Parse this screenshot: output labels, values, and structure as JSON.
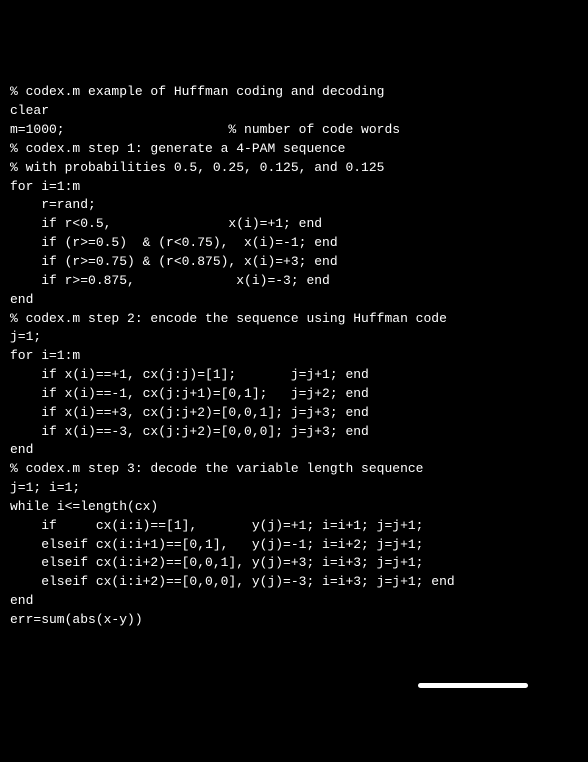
{
  "code": {
    "lines": [
      "% codex.m example of Huffman coding and decoding",
      "clear",
      "m=1000;                     % number of code words",
      "% codex.m step 1: generate a 4-PAM sequence",
      "% with probabilities 0.5, 0.25, 0.125, and 0.125",
      "for i=1:m",
      "    r=rand;",
      "    if r<0.5,               x(i)=+1; end",
      "    if (r>=0.5)  & (r<0.75),  x(i)=-1; end",
      "    if (r>=0.75) & (r<0.875), x(i)=+3; end",
      "    if r>=0.875,             x(i)=-3; end",
      "end",
      "% codex.m step 2: encode the sequence using Huffman code",
      "j=1;",
      "for i=1:m",
      "    if x(i)==+1, cx(j:j)=[1];       j=j+1; end",
      "    if x(i)==-1, cx(j:j+1)=[0,1];   j=j+2; end",
      "    if x(i)==+3, cx(j:j+2)=[0,0,1]; j=j+3; end",
      "    if x(i)==-3, cx(j:j+2)=[0,0,0]; j=j+3; end",
      "end",
      "% codex.m step 3: decode the variable length sequence",
      "j=1; i=1;",
      "while i<=length(cx)",
      "    if     cx(i:i)==[1],       y(j)=+1; i=i+1; j=j+1;",
      "    elseif cx(i:i+1)==[0,1],   y(j)=-1; i=i+2; j=j+1;",
      "    elseif cx(i:i+2)==[0,0,1], y(j)=+3; i=i+3; j=j+1;",
      "    elseif cx(i:i+2)==[0,0,0], y(j)=-3; i=i+3; j=j+1; end",
      "end",
      "err=sum(abs(x-y))"
    ]
  }
}
